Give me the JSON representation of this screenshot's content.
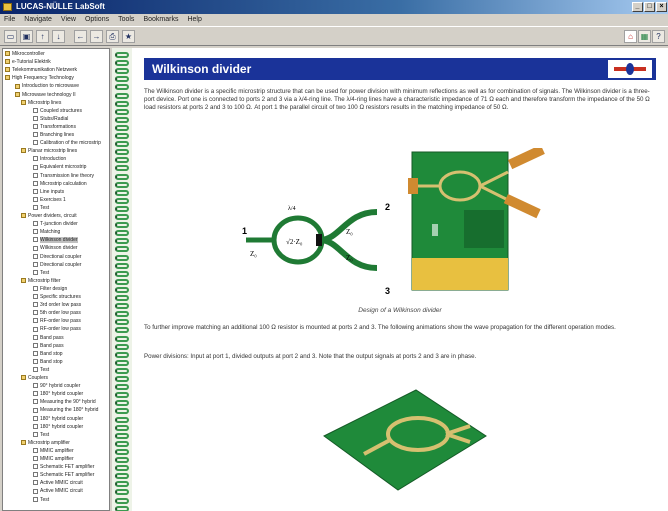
{
  "window": {
    "title": "LUCAS-NÜLLE LabSoft"
  },
  "menu": [
    "File",
    "Navigate",
    "View",
    "Options",
    "Tools",
    "Bookmarks",
    "Help"
  ],
  "toolbar": {
    "buttons": [
      {
        "name": "open-icon",
        "glyph": "▭"
      },
      {
        "name": "save-icon",
        "glyph": "▣"
      },
      {
        "name": "arrow-up-icon",
        "glyph": "↑"
      },
      {
        "name": "arrow-down-icon",
        "glyph": "↓"
      },
      {
        "name": "back-icon",
        "glyph": "←"
      },
      {
        "name": "forward-icon",
        "glyph": "→"
      },
      {
        "name": "print-icon",
        "glyph": "⎙"
      },
      {
        "name": "bookmark-icon",
        "glyph": "★"
      }
    ]
  },
  "tree": [
    {
      "label": "Mikrocontroller",
      "folder": true
    },
    {
      "label": "e-Tutorial Elektrik",
      "folder": true
    },
    {
      "label": "Telekommunikation Netzwerk",
      "folder": true
    },
    {
      "label": "High Frequency Technology",
      "folder": true
    },
    {
      "label": "Introduction to microwave",
      "folder": true
    },
    {
      "label": "Microwave technology II",
      "folder": true
    },
    {
      "label": "Microstrip lines",
      "folder": true
    },
    {
      "label": "Coupled structures",
      "folder": false
    },
    {
      "label": "Stubs/Radial",
      "folder": false
    },
    {
      "label": "Transformations",
      "folder": false
    },
    {
      "label": "Branching lines",
      "folder": false
    },
    {
      "label": "Calibration of the microstrip",
      "folder": false
    },
    {
      "label": "Planar microstrip lines",
      "folder": true
    },
    {
      "label": "Introduction",
      "folder": false
    },
    {
      "label": "Equivalent microstrip",
      "folder": false
    },
    {
      "label": "Transmission line theory",
      "folder": false
    },
    {
      "label": "Microstrip calculation",
      "folder": false
    },
    {
      "label": "Line inputs",
      "folder": false
    },
    {
      "label": "Exercises 1",
      "folder": false
    },
    {
      "label": "Test",
      "folder": false
    },
    {
      "label": "Power dividers, circuit",
      "folder": true
    },
    {
      "label": "T-junction divider",
      "folder": false
    },
    {
      "label": "Matching",
      "folder": false
    },
    {
      "label": "Wilkinson divider",
      "folder": false
    },
    {
      "label": "Wilkinson divider",
      "folder": false
    },
    {
      "label": "Directional coupler",
      "folder": false
    },
    {
      "label": "Directional coupler",
      "folder": false
    },
    {
      "label": "Test",
      "folder": false
    },
    {
      "label": "Microstrip filter",
      "folder": true
    },
    {
      "label": "Filter design",
      "folder": false
    },
    {
      "label": "Specific structures",
      "folder": false
    },
    {
      "label": "3rd order low pass",
      "folder": false
    },
    {
      "label": "5th order low pass",
      "folder": false
    },
    {
      "label": "RF-order low pass",
      "folder": false
    },
    {
      "label": "RF-order low pass",
      "folder": false
    },
    {
      "label": "Band pass",
      "folder": false
    },
    {
      "label": "Band pass",
      "folder": false
    },
    {
      "label": "Band stop",
      "folder": false
    },
    {
      "label": "Band stop",
      "folder": false
    },
    {
      "label": "Test",
      "folder": false
    },
    {
      "label": "Couplers",
      "folder": true
    },
    {
      "label": "90° hybrid coupler",
      "folder": false
    },
    {
      "label": "180° hybrid coupler",
      "folder": false
    },
    {
      "label": "Measuring the 90° hybrid",
      "folder": false
    },
    {
      "label": "Measuring the 180° hybrid",
      "folder": false
    },
    {
      "label": "180° hybrid coupler",
      "folder": false
    },
    {
      "label": "180° hybrid coupler",
      "folder": false
    },
    {
      "label": "Test",
      "folder": false
    },
    {
      "label": "Microstrip amplifier",
      "folder": true
    },
    {
      "label": "MMIC amplifier",
      "folder": false
    },
    {
      "label": "MMIC amplifier",
      "folder": false
    },
    {
      "label": "Schematic FET amplifier",
      "folder": false
    },
    {
      "label": "Schematic FET amplifier",
      "folder": false
    },
    {
      "label": "Active MMIC circuit",
      "folder": false
    },
    {
      "label": "Active MMIC circuit",
      "folder": false
    },
    {
      "label": "Test",
      "folder": false
    }
  ],
  "tree_selected_index": 23,
  "page": {
    "title": "Wilkinson divider",
    "intro": "The Wilkinson divider is a specific microstrip structure that can be used for power division with minimum reflections as well as for combination of signals. The Wilkinson divider is a three-port device. Port one is connected to ports 2 and 3 via a λ/4-ring line. The λ/4-ring lines have a characteristic impedance of 71 Ω each and therefore transform the impedance of the 50 Ω load resistors at ports 2 and 3 to 100 Ω. At port 1 the parallel circuit of two 100 Ω resistors results in the matching impedance of 50 Ω.",
    "figure_caption": "Design of a Wilkinson divider",
    "para2": "To further improve matching an additional 100 Ω resistor is mounted at ports 2 and 3. The following animations show the wave propagation for the different operation modes.",
    "para3": "Power divisions: Input at port 1, divided outputs at port 2 and 3. Note that the output signals at ports 2 and 3 are in phase."
  },
  "diagram": {
    "port1": "1",
    "port2": "2",
    "port3": "3",
    "z0_left": "Z₀",
    "z_ring": "√2·Z₀",
    "z_top": "Z₀",
    "z_bottom": "Z₀",
    "lambda": "λ/4"
  },
  "colors": {
    "header": "#1a3399",
    "pcb": "#1f8a3a",
    "trace": "#e0c060",
    "connector": "#d08a30"
  }
}
